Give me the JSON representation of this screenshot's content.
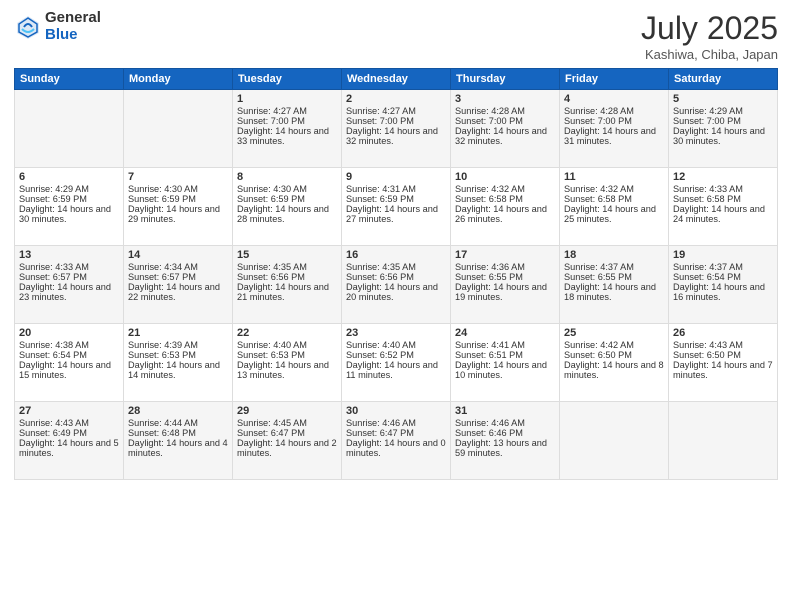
{
  "logo": {
    "general": "General",
    "blue": "Blue"
  },
  "title": "July 2025",
  "location": "Kashiwa, Chiba, Japan",
  "days_of_week": [
    "Sunday",
    "Monday",
    "Tuesday",
    "Wednesday",
    "Thursday",
    "Friday",
    "Saturday"
  ],
  "weeks": [
    [
      {
        "day": "",
        "sunrise": "",
        "sunset": "",
        "daylight": ""
      },
      {
        "day": "",
        "sunrise": "",
        "sunset": "",
        "daylight": ""
      },
      {
        "day": "1",
        "sunrise": "Sunrise: 4:27 AM",
        "sunset": "Sunset: 7:00 PM",
        "daylight": "Daylight: 14 hours and 33 minutes."
      },
      {
        "day": "2",
        "sunrise": "Sunrise: 4:27 AM",
        "sunset": "Sunset: 7:00 PM",
        "daylight": "Daylight: 14 hours and 32 minutes."
      },
      {
        "day": "3",
        "sunrise": "Sunrise: 4:28 AM",
        "sunset": "Sunset: 7:00 PM",
        "daylight": "Daylight: 14 hours and 32 minutes."
      },
      {
        "day": "4",
        "sunrise": "Sunrise: 4:28 AM",
        "sunset": "Sunset: 7:00 PM",
        "daylight": "Daylight: 14 hours and 31 minutes."
      },
      {
        "day": "5",
        "sunrise": "Sunrise: 4:29 AM",
        "sunset": "Sunset: 7:00 PM",
        "daylight": "Daylight: 14 hours and 30 minutes."
      }
    ],
    [
      {
        "day": "6",
        "sunrise": "Sunrise: 4:29 AM",
        "sunset": "Sunset: 6:59 PM",
        "daylight": "Daylight: 14 hours and 30 minutes."
      },
      {
        "day": "7",
        "sunrise": "Sunrise: 4:30 AM",
        "sunset": "Sunset: 6:59 PM",
        "daylight": "Daylight: 14 hours and 29 minutes."
      },
      {
        "day": "8",
        "sunrise": "Sunrise: 4:30 AM",
        "sunset": "Sunset: 6:59 PM",
        "daylight": "Daylight: 14 hours and 28 minutes."
      },
      {
        "day": "9",
        "sunrise": "Sunrise: 4:31 AM",
        "sunset": "Sunset: 6:59 PM",
        "daylight": "Daylight: 14 hours and 27 minutes."
      },
      {
        "day": "10",
        "sunrise": "Sunrise: 4:32 AM",
        "sunset": "Sunset: 6:58 PM",
        "daylight": "Daylight: 14 hours and 26 minutes."
      },
      {
        "day": "11",
        "sunrise": "Sunrise: 4:32 AM",
        "sunset": "Sunset: 6:58 PM",
        "daylight": "Daylight: 14 hours and 25 minutes."
      },
      {
        "day": "12",
        "sunrise": "Sunrise: 4:33 AM",
        "sunset": "Sunset: 6:58 PM",
        "daylight": "Daylight: 14 hours and 24 minutes."
      }
    ],
    [
      {
        "day": "13",
        "sunrise": "Sunrise: 4:33 AM",
        "sunset": "Sunset: 6:57 PM",
        "daylight": "Daylight: 14 hours and 23 minutes."
      },
      {
        "day": "14",
        "sunrise": "Sunrise: 4:34 AM",
        "sunset": "Sunset: 6:57 PM",
        "daylight": "Daylight: 14 hours and 22 minutes."
      },
      {
        "day": "15",
        "sunrise": "Sunrise: 4:35 AM",
        "sunset": "Sunset: 6:56 PM",
        "daylight": "Daylight: 14 hours and 21 minutes."
      },
      {
        "day": "16",
        "sunrise": "Sunrise: 4:35 AM",
        "sunset": "Sunset: 6:56 PM",
        "daylight": "Daylight: 14 hours and 20 minutes."
      },
      {
        "day": "17",
        "sunrise": "Sunrise: 4:36 AM",
        "sunset": "Sunset: 6:55 PM",
        "daylight": "Daylight: 14 hours and 19 minutes."
      },
      {
        "day": "18",
        "sunrise": "Sunrise: 4:37 AM",
        "sunset": "Sunset: 6:55 PM",
        "daylight": "Daylight: 14 hours and 18 minutes."
      },
      {
        "day": "19",
        "sunrise": "Sunrise: 4:37 AM",
        "sunset": "Sunset: 6:54 PM",
        "daylight": "Daylight: 14 hours and 16 minutes."
      }
    ],
    [
      {
        "day": "20",
        "sunrise": "Sunrise: 4:38 AM",
        "sunset": "Sunset: 6:54 PM",
        "daylight": "Daylight: 14 hours and 15 minutes."
      },
      {
        "day": "21",
        "sunrise": "Sunrise: 4:39 AM",
        "sunset": "Sunset: 6:53 PM",
        "daylight": "Daylight: 14 hours and 14 minutes."
      },
      {
        "day": "22",
        "sunrise": "Sunrise: 4:40 AM",
        "sunset": "Sunset: 6:53 PM",
        "daylight": "Daylight: 14 hours and 13 minutes."
      },
      {
        "day": "23",
        "sunrise": "Sunrise: 4:40 AM",
        "sunset": "Sunset: 6:52 PM",
        "daylight": "Daylight: 14 hours and 11 minutes."
      },
      {
        "day": "24",
        "sunrise": "Sunrise: 4:41 AM",
        "sunset": "Sunset: 6:51 PM",
        "daylight": "Daylight: 14 hours and 10 minutes."
      },
      {
        "day": "25",
        "sunrise": "Sunrise: 4:42 AM",
        "sunset": "Sunset: 6:50 PM",
        "daylight": "Daylight: 14 hours and 8 minutes."
      },
      {
        "day": "26",
        "sunrise": "Sunrise: 4:43 AM",
        "sunset": "Sunset: 6:50 PM",
        "daylight": "Daylight: 14 hours and 7 minutes."
      }
    ],
    [
      {
        "day": "27",
        "sunrise": "Sunrise: 4:43 AM",
        "sunset": "Sunset: 6:49 PM",
        "daylight": "Daylight: 14 hours and 5 minutes."
      },
      {
        "day": "28",
        "sunrise": "Sunrise: 4:44 AM",
        "sunset": "Sunset: 6:48 PM",
        "daylight": "Daylight: 14 hours and 4 minutes."
      },
      {
        "day": "29",
        "sunrise": "Sunrise: 4:45 AM",
        "sunset": "Sunset: 6:47 PM",
        "daylight": "Daylight: 14 hours and 2 minutes."
      },
      {
        "day": "30",
        "sunrise": "Sunrise: 4:46 AM",
        "sunset": "Sunset: 6:47 PM",
        "daylight": "Daylight: 14 hours and 0 minutes."
      },
      {
        "day": "31",
        "sunrise": "Sunrise: 4:46 AM",
        "sunset": "Sunset: 6:46 PM",
        "daylight": "Daylight: 13 hours and 59 minutes."
      },
      {
        "day": "",
        "sunrise": "",
        "sunset": "",
        "daylight": ""
      },
      {
        "day": "",
        "sunrise": "",
        "sunset": "",
        "daylight": ""
      }
    ]
  ]
}
